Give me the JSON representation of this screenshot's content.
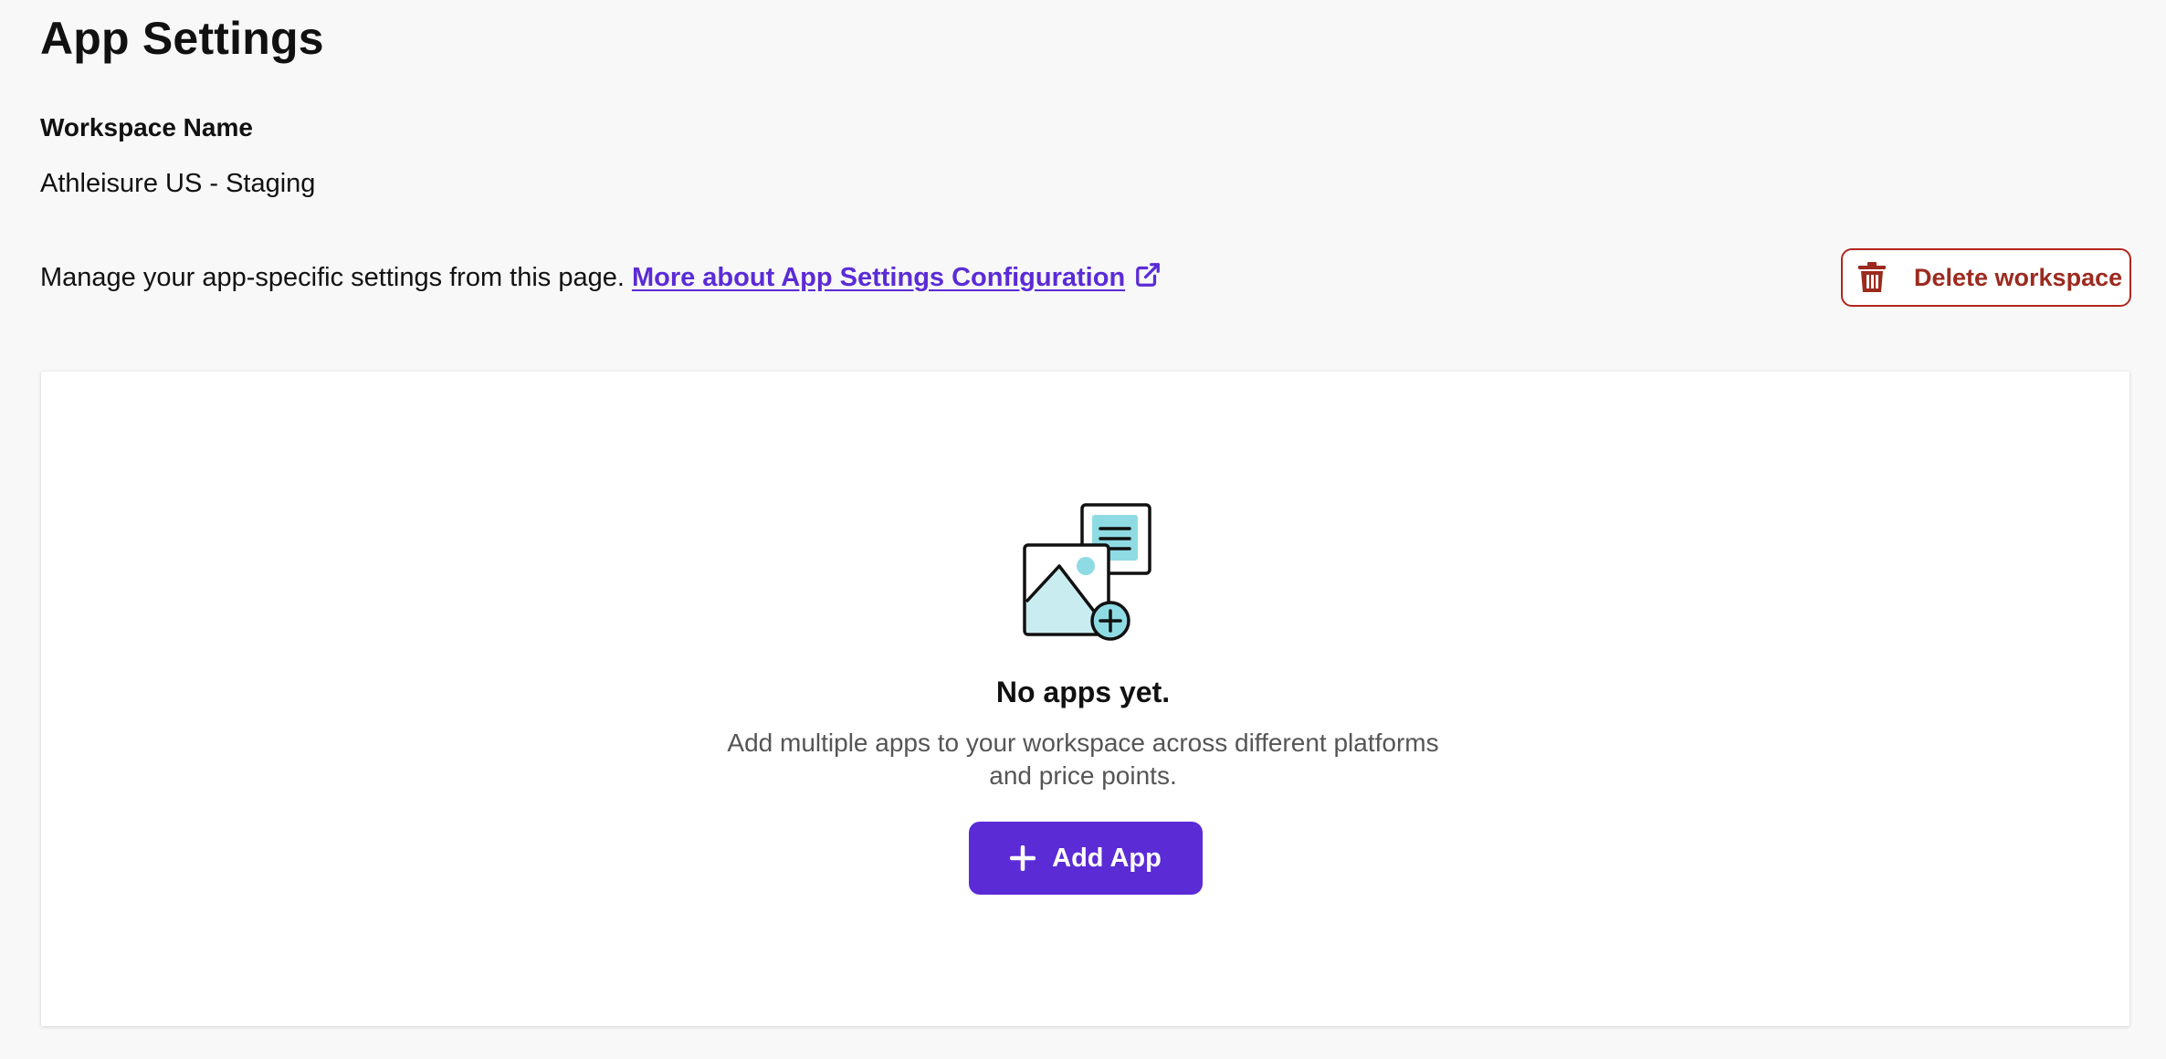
{
  "page": {
    "title": "App Settings"
  },
  "workspace": {
    "label": "Workspace Name",
    "value": "Athleisure US - Staging"
  },
  "manage": {
    "text": "Manage your app-specific settings from this page.",
    "link_label": "More about App Settings Configuration",
    "link_icon": "external-link-icon"
  },
  "delete_button": {
    "label": "Delete workspace",
    "icon": "trash-icon",
    "color": "#b3261e"
  },
  "empty_state": {
    "illustration": "add-media-illustration",
    "title": "No apps yet.",
    "description": "Add multiple apps to your workspace across different platforms and price points.",
    "add_button": {
      "label": "Add App",
      "icon": "plus-icon",
      "color": "#5b2bd6"
    }
  }
}
